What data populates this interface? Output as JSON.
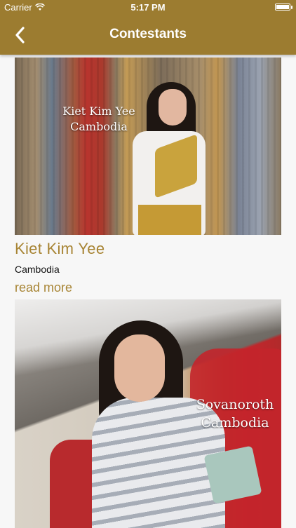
{
  "status_bar": {
    "carrier": "Carrier",
    "time": "5:17 PM",
    "icons": [
      "wifi-icon",
      "battery-icon"
    ]
  },
  "nav": {
    "title": "Contestants",
    "back_icon": "chevron-left-icon"
  },
  "colors": {
    "header_bg": "#9c7c30",
    "accent_text": "#a88535"
  },
  "contestants": [
    {
      "photo_caption_name": "Kiet Kim Yee",
      "photo_caption_country": "Cambodia",
      "name": "Kiet Kim Yee",
      "country": "Cambodia",
      "read_more": "read more"
    },
    {
      "photo_caption_name": "Sovanoroth",
      "photo_caption_country": "Cambodia"
    }
  ]
}
